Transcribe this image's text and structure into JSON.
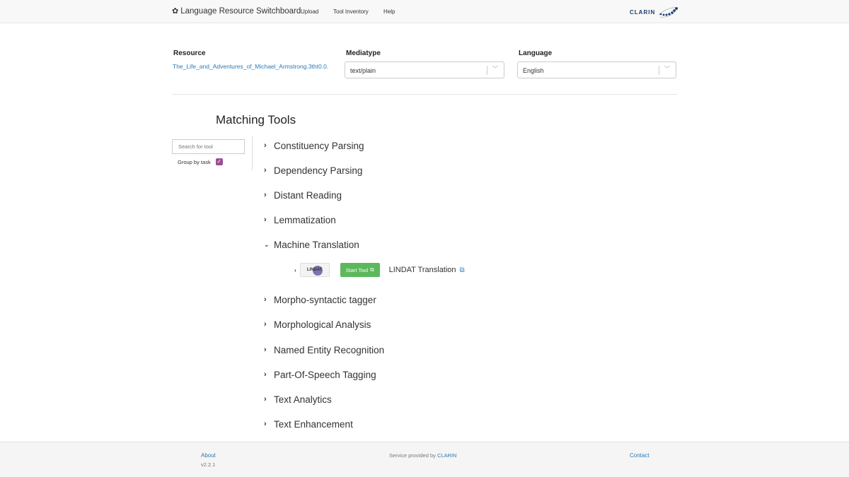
{
  "navbar": {
    "brand": "Language Resource Switchboard",
    "links": [
      "Upload",
      "Tool Inventory",
      "Help"
    ],
    "logo_text": "CLARIN"
  },
  "resource": {
    "resource_label": "Resource",
    "resource_value": "The_Life_and_Adventures_of_Michael_Armstrong.3tht0.0.",
    "mediatype_label": "Mediatype",
    "mediatype_value": "text/plain",
    "language_label": "Language",
    "language_value": "English"
  },
  "tools": {
    "title": "Matching Tools",
    "search_placeholder": "Search for tool",
    "group_label": "Group by task",
    "group_checked": true,
    "tasks": [
      "Constituency Parsing",
      "Dependency Parsing",
      "Distant Reading",
      "Lemmatization",
      "Machine Translation",
      "Morpho-syntactic tagger",
      "Morphological Analysis",
      "Named Entity Recognition",
      "Part-Of-Speech Tagging",
      "Text Analytics",
      "Text Enhancement"
    ],
    "expanded_task": "Machine Translation",
    "expanded_tool": {
      "logo_text": "LINDAT",
      "start_label": "Start Tool",
      "name": "LINDAT Translation"
    }
  },
  "footer": {
    "about": "About",
    "version": "v2.2.1",
    "service_prefix": "Service provided by",
    "service_link": "CLARIN",
    "contact": "Contact"
  },
  "colors": {
    "link": "#2a7ab8",
    "start_button": "#5cb85c",
    "checkbox": "#9b4f96"
  }
}
